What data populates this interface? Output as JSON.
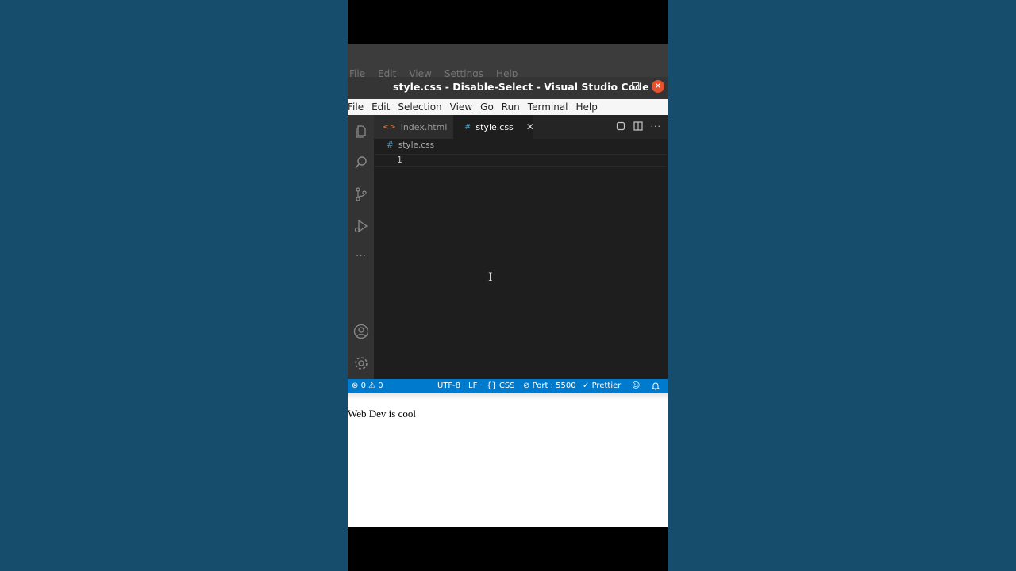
{
  "ghost_menu": [
    "File",
    "Edit",
    "View",
    "Settings",
    "Help"
  ],
  "window": {
    "title": "style.css - Disable-Select - Visual Studio Code",
    "minimize": "–",
    "close": "✕"
  },
  "menubar": [
    "File",
    "Edit",
    "Selection",
    "View",
    "Go",
    "Run",
    "Terminal",
    "Help"
  ],
  "tabs": [
    {
      "label": "index.html",
      "icon": "<>"
    },
    {
      "label": "style.css",
      "icon": "#",
      "close": "✕"
    }
  ],
  "breadcrumb": {
    "icon": "#",
    "label": "style.css"
  },
  "editor": {
    "line_number": "1",
    "cursor": "I"
  },
  "statusbar": {
    "errors": "0",
    "warnings": "0",
    "encoding": "UTF-8",
    "eol": "LF",
    "language": "CSS",
    "port": "Port : 5500",
    "formatter": "Prettier"
  },
  "browser": {
    "text": "Web Dev is cool"
  }
}
